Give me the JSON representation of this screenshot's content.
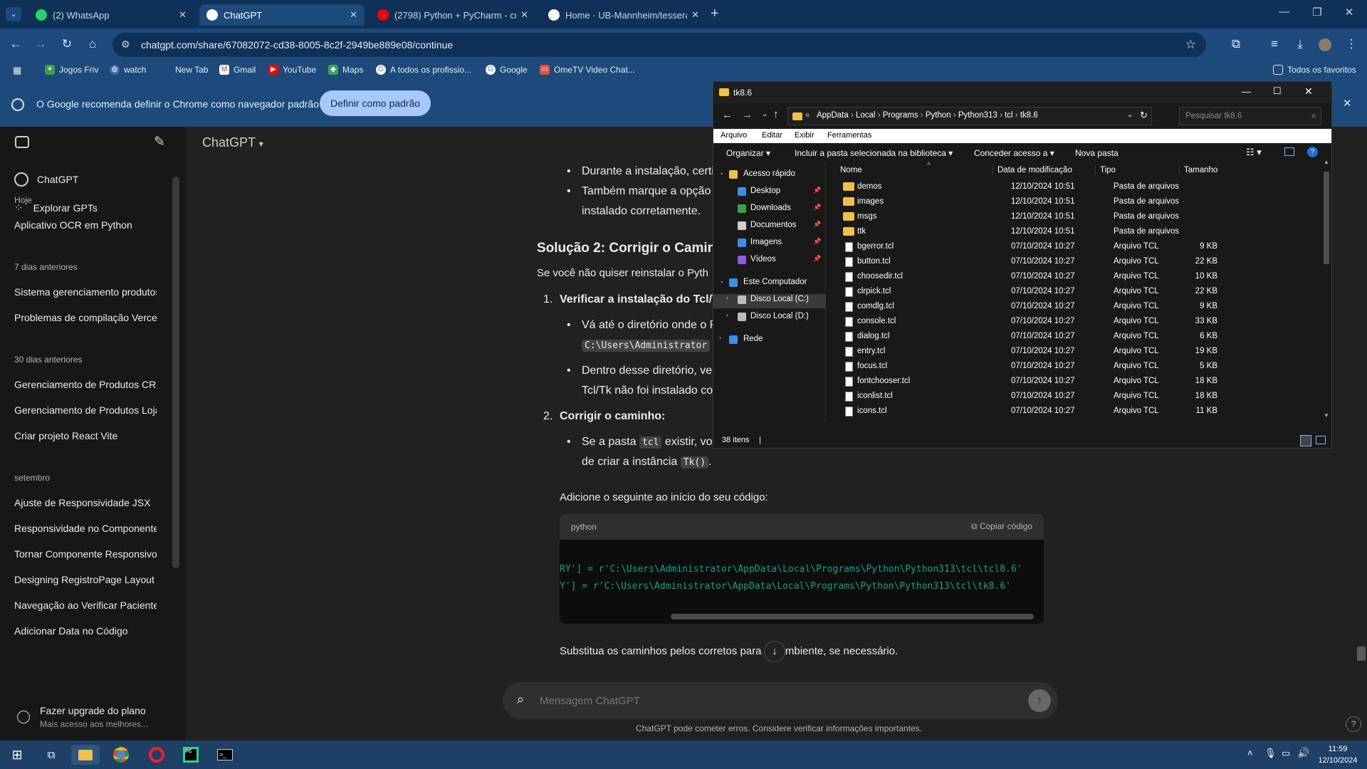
{
  "browser": {
    "tabs": [
      {
        "title": "(2) WhatsApp",
        "icon": "whatsapp-icon",
        "color": "#25d366",
        "active": false
      },
      {
        "title": "ChatGPT",
        "icon": "chatgpt-icon",
        "color": "#ffffff",
        "active": true
      },
      {
        "title": "(2798) Python + PyCharm - cria",
        "icon": "youtube-icon",
        "color": "#ff0000",
        "active": false
      },
      {
        "title": "Home · UB-Mannheim/tesserac",
        "icon": "github-icon",
        "color": "#ffffff",
        "active": false
      }
    ],
    "url": "chatgpt.com/share/67082072-cd38-8005-8c2f-2949be889e08/continue",
    "bookmarks": [
      "Jogos Friv",
      "watch",
      "New Tab",
      "Gmail",
      "YouTube",
      "Maps",
      "A todos os profissio...",
      "Google",
      "OmeTV Video Chat..."
    ],
    "all_bookmarks": "Todos os favoritos",
    "infobar_message": "O Google recomenda definir o Chrome como navegador padrão",
    "infobar_button": "Definir como padrão"
  },
  "sidebar": {
    "top_items": [
      "ChatGPT",
      "Explorar GPTs"
    ],
    "sections": [
      {
        "label": "Hoje",
        "items": [
          "Aplicativo OCR em Python"
        ]
      },
      {
        "label": "7 dias anteriores",
        "items": [
          "Sistema gerenciamento produtos",
          "Problemas de compilação Vercel"
        ]
      },
      {
        "label": "30 dias anteriores",
        "items": [
          "Gerenciamento de Produtos CRUD",
          "Gerenciamento de Produtos Loja",
          "Criar projeto React Vite"
        ]
      },
      {
        "label": "setembro",
        "items": [
          "Ajuste de Responsividade JSX",
          "Responsividade no Componente",
          "Tornar Componente Responsivo",
          "Designing RegistroPage Layout",
          "Navegação ao Verificar Pacientes",
          "Adicionar Data no Código"
        ]
      }
    ],
    "upgrade_title": "Fazer upgrade do plano",
    "upgrade_subtitle": "Mais acesso aos melhores..."
  },
  "main": {
    "model_label": "ChatGPT",
    "bullet1": "Durante a instalação, certif",
    "bullet2a": "Também marque a opção \"",
    "bullet2b": "instalado corretamente.",
    "heading": "Solução 2: Corrigir o Camin",
    "intro": "Se você não quiser reinstalar o Pyth",
    "step1_title": "Verificar a instalação do Tcl/Tk",
    "step1_a": "Vá até o diretório onde o P",
    "step1_code": "C:\\Users\\Administrator",
    "step1_b": "Dentro desse diretório, ver",
    "step1_c": "Tcl/Tk não foi instalado cor",
    "step2_title": "Corrigir o caminho:",
    "step2_a1": "Se a pasta ",
    "step2_code1": "tcl",
    "step2_a2": " existir, voc",
    "step2_b1": "de criar a instância ",
    "step2_code2": "Tk()",
    "step2_b2": ".",
    "code_intro": "Adicione o seguinte ao início do seu código:",
    "code_lang": "python",
    "copy_label": "Copiar código",
    "code_lines": [
      "RY'] = r'C:\\Users\\Administrator\\AppData\\Local\\Programs\\Python\\Python313\\tcl\\tcl8.6'",
      "Y'] = r'C:\\Users\\Administrator\\AppData\\Local\\Programs\\Python\\Python313\\tcl\\tk8.6'"
    ],
    "after_code_a": "Substitua os caminhos pelos corretos para ",
    "after_code_b": "eu ambiente, se necessário.",
    "composer_placeholder": "Mensagem ChatGPT",
    "disclaimer": "ChatGPT pode cometer erros. Considere verificar informações importantes."
  },
  "explorer": {
    "title": "tk8.6",
    "path": [
      "AppData",
      "Local",
      "Programs",
      "Python",
      "Python313",
      "tcl",
      "tk8.6"
    ],
    "search_placeholder": "Pesquisar tk8.6",
    "menu": [
      "Arquivo",
      "Editar",
      "Exibir",
      "Ferramentas"
    ],
    "commands": [
      "Organizar",
      "Incluir a pasta selecionada na biblioteca",
      "Conceder acesso a",
      "Nova pasta"
    ],
    "nav": [
      {
        "label": "Acesso rápido",
        "icon": "star-icon"
      },
      {
        "label": "Desktop",
        "icon": "desktop-icon"
      },
      {
        "label": "Downloads",
        "icon": "download-icon"
      },
      {
        "label": "Documentos",
        "icon": "document-icon"
      },
      {
        "label": "Imagens",
        "icon": "image-icon"
      },
      {
        "label": "Vídeos",
        "icon": "video-icon"
      },
      {
        "label": "Este Computador",
        "icon": "computer-icon"
      },
      {
        "label": "Disco Local (C:)",
        "icon": "drive-icon"
      },
      {
        "label": "Disco Local (D:)",
        "icon": "drive-icon"
      },
      {
        "label": "Rede",
        "icon": "network-icon"
      }
    ],
    "columns": [
      "Nome",
      "Data de modificação",
      "Tipo",
      "Tamanho"
    ],
    "files": [
      {
        "name": "demos",
        "date": "12/10/2024 10:51",
        "type": "Pasta de arquivos",
        "size": "",
        "folder": true
      },
      {
        "name": "images",
        "date": "12/10/2024 10:51",
        "type": "Pasta de arquivos",
        "size": "",
        "folder": true
      },
      {
        "name": "msgs",
        "date": "12/10/2024 10:51",
        "type": "Pasta de arquivos",
        "size": "",
        "folder": true
      },
      {
        "name": "ttk",
        "date": "12/10/2024 10:51",
        "type": "Pasta de arquivos",
        "size": "",
        "folder": true
      },
      {
        "name": "bgerror.tcl",
        "date": "07/10/2024 10:27",
        "type": "Arquivo TCL",
        "size": "9 KB",
        "folder": false
      },
      {
        "name": "button.tcl",
        "date": "07/10/2024 10:27",
        "type": "Arquivo TCL",
        "size": "22 KB",
        "folder": false
      },
      {
        "name": "choosedir.tcl",
        "date": "07/10/2024 10:27",
        "type": "Arquivo TCL",
        "size": "10 KB",
        "folder": false
      },
      {
        "name": "clrpick.tcl",
        "date": "07/10/2024 10:27",
        "type": "Arquivo TCL",
        "size": "22 KB",
        "folder": false
      },
      {
        "name": "comdlg.tcl",
        "date": "07/10/2024 10:27",
        "type": "Arquivo TCL",
        "size": "9 KB",
        "folder": false
      },
      {
        "name": "console.tcl",
        "date": "07/10/2024 10:27",
        "type": "Arquivo TCL",
        "size": "33 KB",
        "folder": false
      },
      {
        "name": "dialog.tcl",
        "date": "07/10/2024 10:27",
        "type": "Arquivo TCL",
        "size": "6 KB",
        "folder": false
      },
      {
        "name": "entry.tcl",
        "date": "07/10/2024 10:27",
        "type": "Arquivo TCL",
        "size": "19 KB",
        "folder": false
      },
      {
        "name": "focus.tcl",
        "date": "07/10/2024 10:27",
        "type": "Arquivo TCL",
        "size": "5 KB",
        "folder": false
      },
      {
        "name": "fontchooser.tcl",
        "date": "07/10/2024 10:27",
        "type": "Arquivo TCL",
        "size": "18 KB",
        "folder": false
      },
      {
        "name": "iconlist.tcl",
        "date": "07/10/2024 10:27",
        "type": "Arquivo TCL",
        "size": "18 KB",
        "folder": false
      },
      {
        "name": "icons.tcl",
        "date": "07/10/2024 10:27",
        "type": "Arquivo TCL",
        "size": "11 KB",
        "folder": false
      }
    ],
    "status": "38 itens"
  },
  "taskbar": {
    "time": "11:59",
    "date": "12/10/2024",
    "apps": [
      "windows-start-icon",
      "task-view-icon",
      "file-explorer-icon",
      "chrome-icon",
      "opera-icon",
      "pycharm-icon",
      "terminal-icon"
    ]
  }
}
